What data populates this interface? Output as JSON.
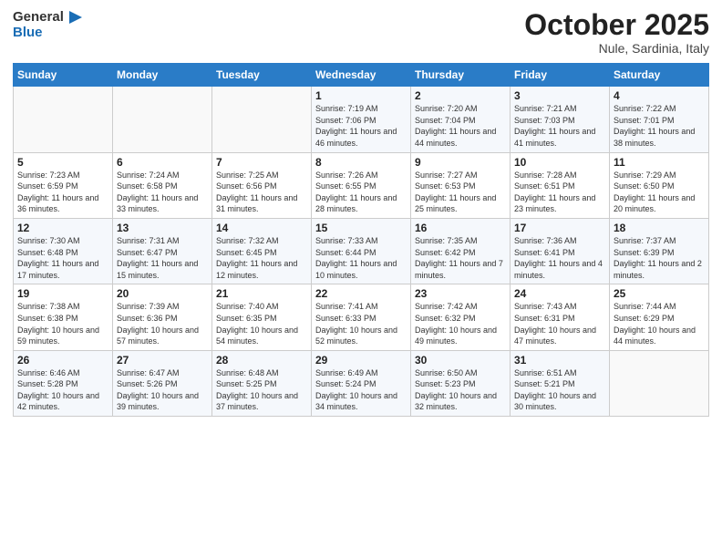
{
  "header": {
    "logo_general": "General",
    "logo_blue": "Blue",
    "month": "October 2025",
    "location": "Nule, Sardinia, Italy"
  },
  "days_of_week": [
    "Sunday",
    "Monday",
    "Tuesday",
    "Wednesday",
    "Thursday",
    "Friday",
    "Saturday"
  ],
  "weeks": [
    [
      {
        "day": "",
        "info": ""
      },
      {
        "day": "",
        "info": ""
      },
      {
        "day": "",
        "info": ""
      },
      {
        "day": "1",
        "info": "Sunrise: 7:19 AM\nSunset: 7:06 PM\nDaylight: 11 hours and 46 minutes."
      },
      {
        "day": "2",
        "info": "Sunrise: 7:20 AM\nSunset: 7:04 PM\nDaylight: 11 hours and 44 minutes."
      },
      {
        "day": "3",
        "info": "Sunrise: 7:21 AM\nSunset: 7:03 PM\nDaylight: 11 hours and 41 minutes."
      },
      {
        "day": "4",
        "info": "Sunrise: 7:22 AM\nSunset: 7:01 PM\nDaylight: 11 hours and 38 minutes."
      }
    ],
    [
      {
        "day": "5",
        "info": "Sunrise: 7:23 AM\nSunset: 6:59 PM\nDaylight: 11 hours and 36 minutes."
      },
      {
        "day": "6",
        "info": "Sunrise: 7:24 AM\nSunset: 6:58 PM\nDaylight: 11 hours and 33 minutes."
      },
      {
        "day": "7",
        "info": "Sunrise: 7:25 AM\nSunset: 6:56 PM\nDaylight: 11 hours and 31 minutes."
      },
      {
        "day": "8",
        "info": "Sunrise: 7:26 AM\nSunset: 6:55 PM\nDaylight: 11 hours and 28 minutes."
      },
      {
        "day": "9",
        "info": "Sunrise: 7:27 AM\nSunset: 6:53 PM\nDaylight: 11 hours and 25 minutes."
      },
      {
        "day": "10",
        "info": "Sunrise: 7:28 AM\nSunset: 6:51 PM\nDaylight: 11 hours and 23 minutes."
      },
      {
        "day": "11",
        "info": "Sunrise: 7:29 AM\nSunset: 6:50 PM\nDaylight: 11 hours and 20 minutes."
      }
    ],
    [
      {
        "day": "12",
        "info": "Sunrise: 7:30 AM\nSunset: 6:48 PM\nDaylight: 11 hours and 17 minutes."
      },
      {
        "day": "13",
        "info": "Sunrise: 7:31 AM\nSunset: 6:47 PM\nDaylight: 11 hours and 15 minutes."
      },
      {
        "day": "14",
        "info": "Sunrise: 7:32 AM\nSunset: 6:45 PM\nDaylight: 11 hours and 12 minutes."
      },
      {
        "day": "15",
        "info": "Sunrise: 7:33 AM\nSunset: 6:44 PM\nDaylight: 11 hours and 10 minutes."
      },
      {
        "day": "16",
        "info": "Sunrise: 7:35 AM\nSunset: 6:42 PM\nDaylight: 11 hours and 7 minutes."
      },
      {
        "day": "17",
        "info": "Sunrise: 7:36 AM\nSunset: 6:41 PM\nDaylight: 11 hours and 4 minutes."
      },
      {
        "day": "18",
        "info": "Sunrise: 7:37 AM\nSunset: 6:39 PM\nDaylight: 11 hours and 2 minutes."
      }
    ],
    [
      {
        "day": "19",
        "info": "Sunrise: 7:38 AM\nSunset: 6:38 PM\nDaylight: 10 hours and 59 minutes."
      },
      {
        "day": "20",
        "info": "Sunrise: 7:39 AM\nSunset: 6:36 PM\nDaylight: 10 hours and 57 minutes."
      },
      {
        "day": "21",
        "info": "Sunrise: 7:40 AM\nSunset: 6:35 PM\nDaylight: 10 hours and 54 minutes."
      },
      {
        "day": "22",
        "info": "Sunrise: 7:41 AM\nSunset: 6:33 PM\nDaylight: 10 hours and 52 minutes."
      },
      {
        "day": "23",
        "info": "Sunrise: 7:42 AM\nSunset: 6:32 PM\nDaylight: 10 hours and 49 minutes."
      },
      {
        "day": "24",
        "info": "Sunrise: 7:43 AM\nSunset: 6:31 PM\nDaylight: 10 hours and 47 minutes."
      },
      {
        "day": "25",
        "info": "Sunrise: 7:44 AM\nSunset: 6:29 PM\nDaylight: 10 hours and 44 minutes."
      }
    ],
    [
      {
        "day": "26",
        "info": "Sunrise: 6:46 AM\nSunset: 5:28 PM\nDaylight: 10 hours and 42 minutes."
      },
      {
        "day": "27",
        "info": "Sunrise: 6:47 AM\nSunset: 5:26 PM\nDaylight: 10 hours and 39 minutes."
      },
      {
        "day": "28",
        "info": "Sunrise: 6:48 AM\nSunset: 5:25 PM\nDaylight: 10 hours and 37 minutes."
      },
      {
        "day": "29",
        "info": "Sunrise: 6:49 AM\nSunset: 5:24 PM\nDaylight: 10 hours and 34 minutes."
      },
      {
        "day": "30",
        "info": "Sunrise: 6:50 AM\nSunset: 5:23 PM\nDaylight: 10 hours and 32 minutes."
      },
      {
        "day": "31",
        "info": "Sunrise: 6:51 AM\nSunset: 5:21 PM\nDaylight: 10 hours and 30 minutes."
      },
      {
        "day": "",
        "info": ""
      }
    ]
  ]
}
